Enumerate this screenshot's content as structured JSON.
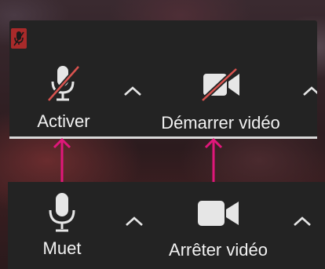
{
  "top_toolbar": {
    "audio": {
      "label": "Activer",
      "icon": "microphone-muted-icon"
    },
    "video": {
      "label": "Démarrer vidéo",
      "icon": "video-camera-off-icon"
    }
  },
  "bottom_toolbar": {
    "audio": {
      "label": "Muet",
      "icon": "microphone-icon"
    },
    "video": {
      "label": "Arrêter vidéo",
      "icon": "video-camera-icon"
    }
  },
  "colors": {
    "toolbar_bg": "#232323",
    "muted_red": "#d9534f",
    "arrow_pink": "#e0177a",
    "label_text": "#f2f2f2"
  }
}
